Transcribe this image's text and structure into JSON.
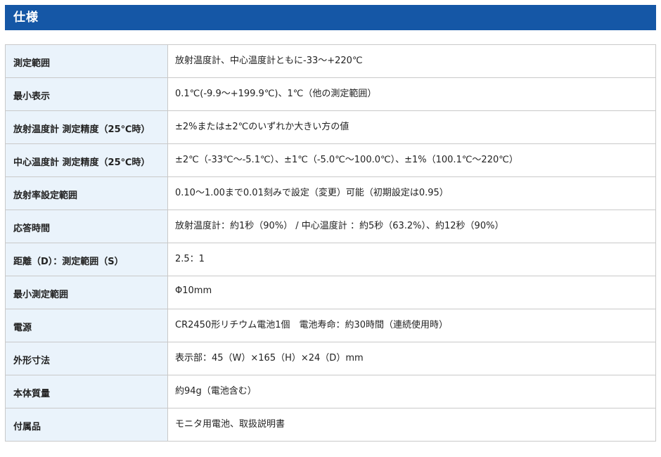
{
  "header": {
    "title": "仕様"
  },
  "colors": {
    "header_bg": "#1557a6",
    "label_bg": "#eaf3fb",
    "border": "#c9c9c9"
  },
  "specs": [
    {
      "label": "測定範囲",
      "value": "放射温度計、中心温度計ともに-33〜+220℃"
    },
    {
      "label": "最小表示",
      "value": "0.1℃(-9.9〜+199.9℃)、1℃（他の測定範囲）"
    },
    {
      "label": "放射温度計 測定精度（25℃時）",
      "value": "±2%または±2℃のいずれか大きい方の値"
    },
    {
      "label": "中心温度計 測定精度（25℃時）",
      "value": "±2℃（-33℃〜-5.1℃）、±1℃（-5.0℃〜100.0℃）、±1%（100.1℃〜220℃）"
    },
    {
      "label": "放射率設定範囲",
      "value": "0.10〜1.00まで0.01刻みで設定（変更）可能（初期設定は0.95）"
    },
    {
      "label": "応答時間",
      "value": "放射温度計：約1秒（90%） / 中心温度計 ：約5秒（63.2%）、約12秒（90%）"
    },
    {
      "label": "距離（D）：測定範囲（S）",
      "value": "2.5：1"
    },
    {
      "label": "最小測定範囲",
      "value": "Φ10mm"
    },
    {
      "label": "電源",
      "value": "CR2450形リチウム電池1個　電池寿命：約30時間（連続使用時）"
    },
    {
      "label": "外形寸法",
      "value": "表示部：45（W）×165（H）×24（D）mm"
    },
    {
      "label": "本体質量",
      "value": "約94g（電池含む）"
    },
    {
      "label": "付属品",
      "value": "モニタ用電池、取扱説明書"
    }
  ]
}
